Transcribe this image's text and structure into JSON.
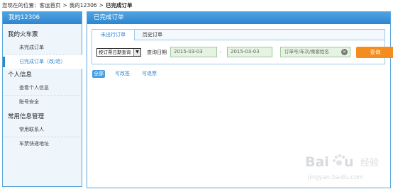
{
  "breadcrumb": {
    "prefix": "您现在的位置：",
    "items": [
      "客运首页",
      "我的12306",
      "已完成订单"
    ]
  },
  "sidebar": {
    "title": "我的12306",
    "sections": [
      {
        "label": "我的火车票",
        "items": [
          "未完成订单",
          "已完成订单（改/退）"
        ]
      },
      {
        "label": "个人信息",
        "items": [
          "查看个人信息",
          "账号安全"
        ]
      },
      {
        "label": "常用信息管理",
        "items": [
          "常用联系人",
          "车票快递地址"
        ]
      }
    ]
  },
  "main": {
    "title": "已完成订单",
    "tabs": [
      "未出行订单",
      "历史订单"
    ],
    "select_value": "按订票日期查询",
    "date_label": "查询日期",
    "start_date": "2015-03-03",
    "dash": "-",
    "end_date": "2015-03-03",
    "search_placeholder": "订单号/车次/乘客姓名",
    "query_button": "查询",
    "filters": [
      "全部",
      "可改签",
      "可退票"
    ]
  },
  "watermark": {
    "brand": "Baidu 经验",
    "url": "jingyan.baidu.com"
  },
  "colors": {
    "accent": "#2e86cf",
    "button": "#f58c1f",
    "input_bg": "#e6f2e2"
  }
}
